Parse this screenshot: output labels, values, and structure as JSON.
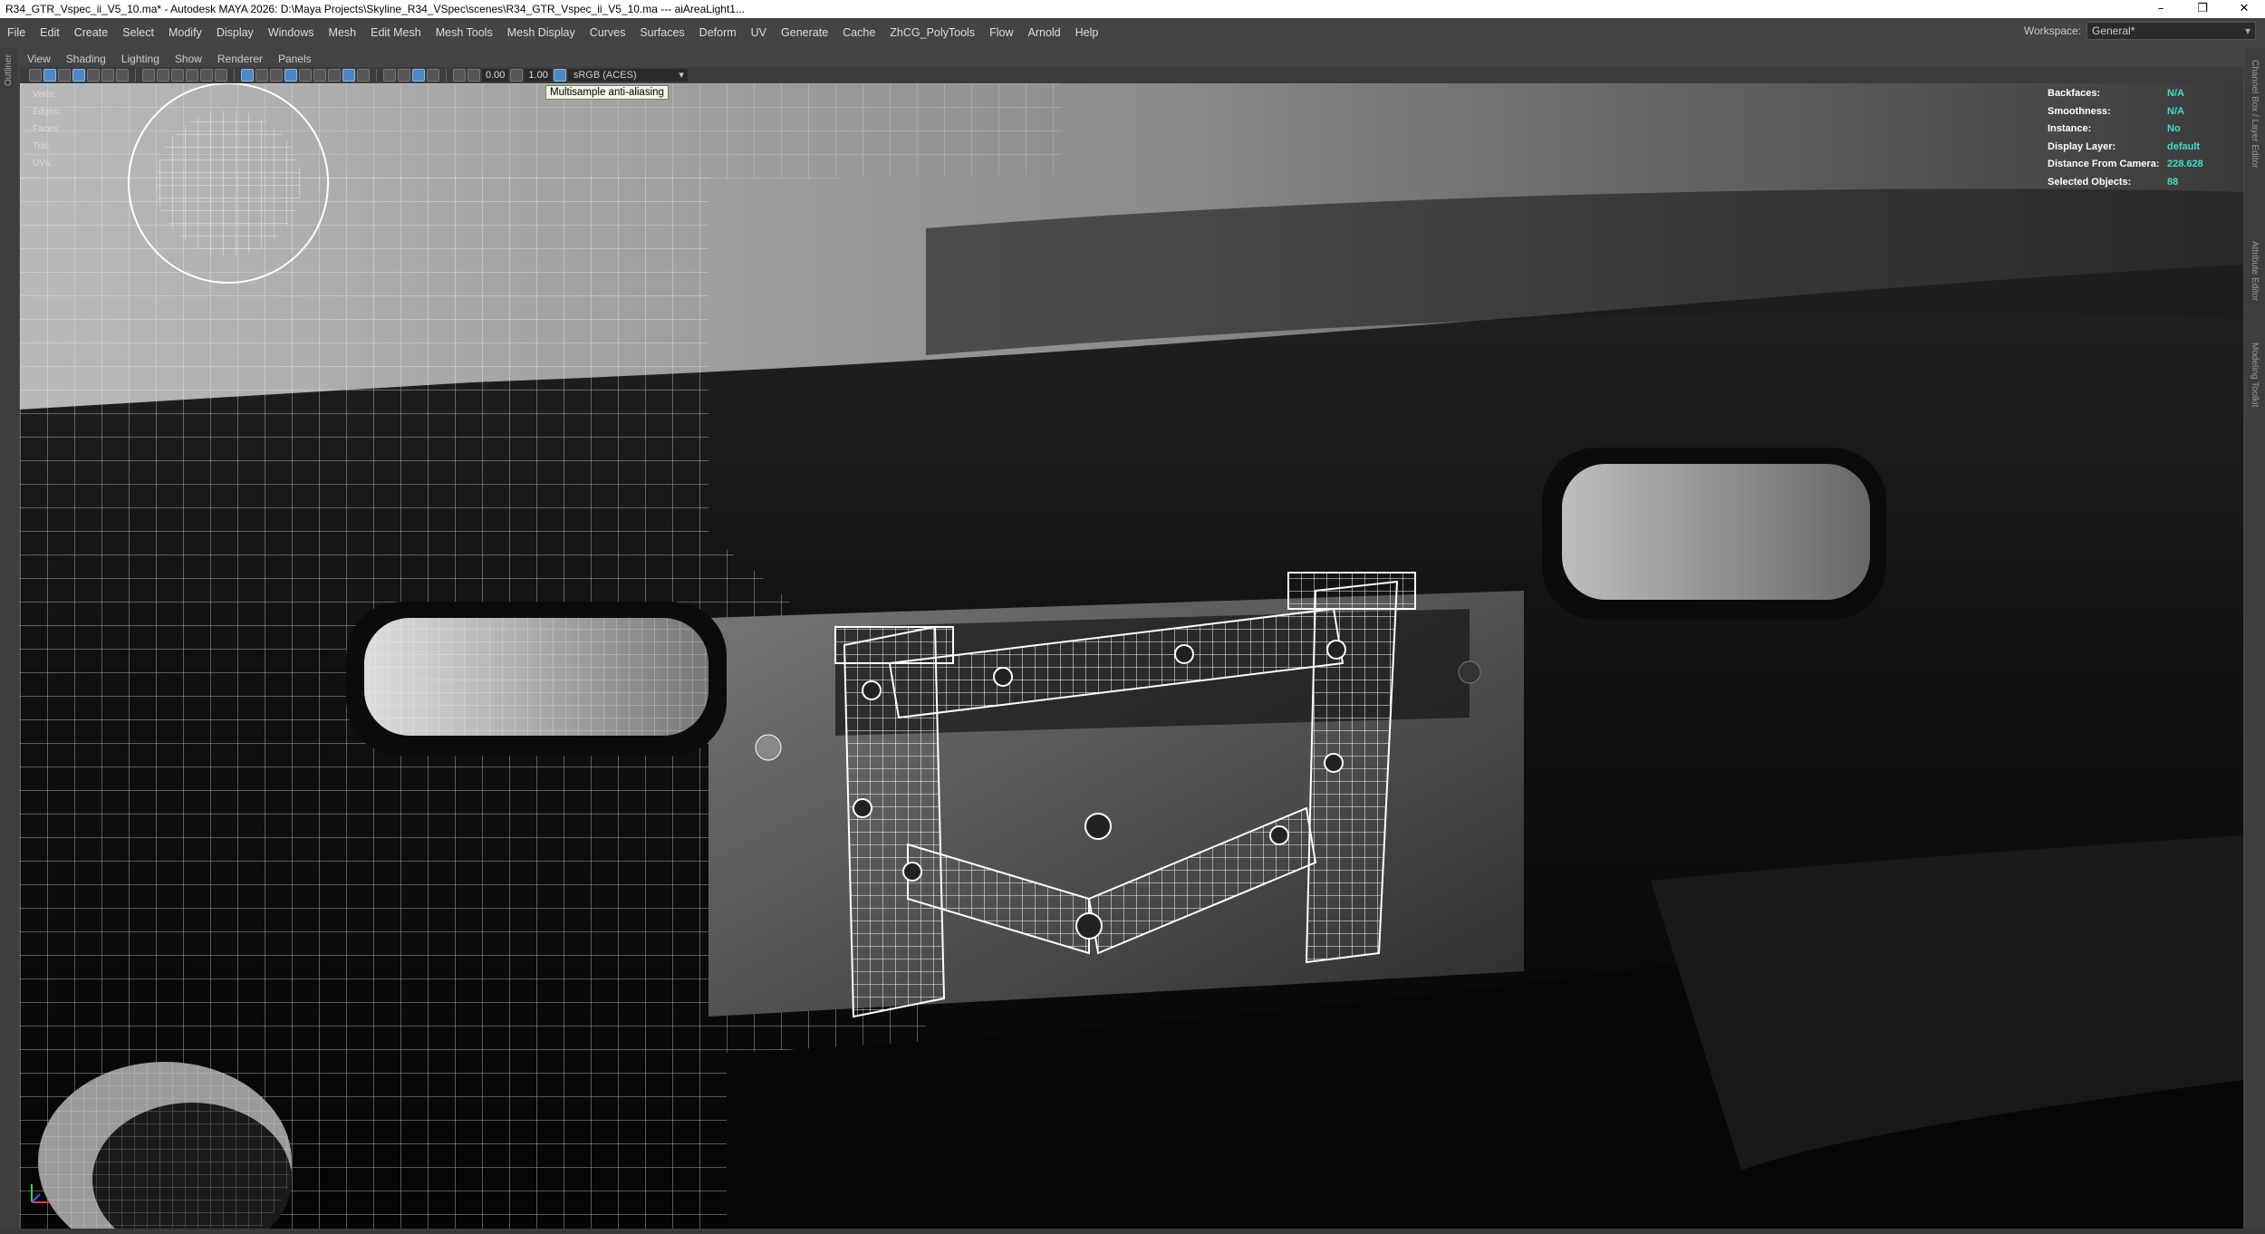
{
  "window": {
    "title": "R34_GTR_Vspec_ii_V5_10.ma* - Autodesk MAYA 2026: D:\\Maya Projects\\Skyline_R34_VSpec\\scenes\\R34_GTR_Vspec_ii_V5_10.ma  ---  aiAreaLight1...",
    "controls": [
      "–",
      "❐",
      "✕"
    ]
  },
  "menubar": {
    "items": [
      "File",
      "Edit",
      "Create",
      "Select",
      "Modify",
      "Display",
      "Windows",
      "Mesh",
      "Edit Mesh",
      "Mesh Tools",
      "Mesh Display",
      "Curves",
      "Surfaces",
      "Deform",
      "UV",
      "Generate",
      "Cache",
      "ZhCG_PolyTools",
      "Flow",
      "Arnold",
      "Help"
    ]
  },
  "workspace": {
    "label": "Workspace:",
    "value": "General*"
  },
  "side_strips": {
    "left": "Outliner",
    "right": [
      "Channel Box / Layer Editor",
      "Attribute Editor",
      "Modeling Toolkit"
    ]
  },
  "panel": {
    "menus": [
      "View",
      "Shading",
      "Lighting",
      "Show",
      "Renderer",
      "Panels"
    ],
    "exposure": "0.00",
    "gamma": "1.00",
    "color_space": "sRGB (ACES)",
    "tooltip": "Multisample anti-aliasing"
  },
  "hud_left": {
    "rows": [
      "Verts:",
      "Edges:",
      "Faces:",
      "Tris:",
      "UVs:"
    ]
  },
  "hud_right": [
    {
      "label": "Backfaces:",
      "value": "N/A"
    },
    {
      "label": "Smoothness:",
      "value": "N/A"
    },
    {
      "label": "Instance:",
      "value": "No"
    },
    {
      "label": "Display Layer:",
      "value": "default"
    },
    {
      "label": "Distance From Camera:",
      "value": "228.628"
    },
    {
      "label": "Selected Objects:",
      "value": "88"
    }
  ],
  "colors": {
    "hud_value": "#3fe0c4",
    "active_icon": "#4d88c6",
    "wire": "#ffffff"
  }
}
